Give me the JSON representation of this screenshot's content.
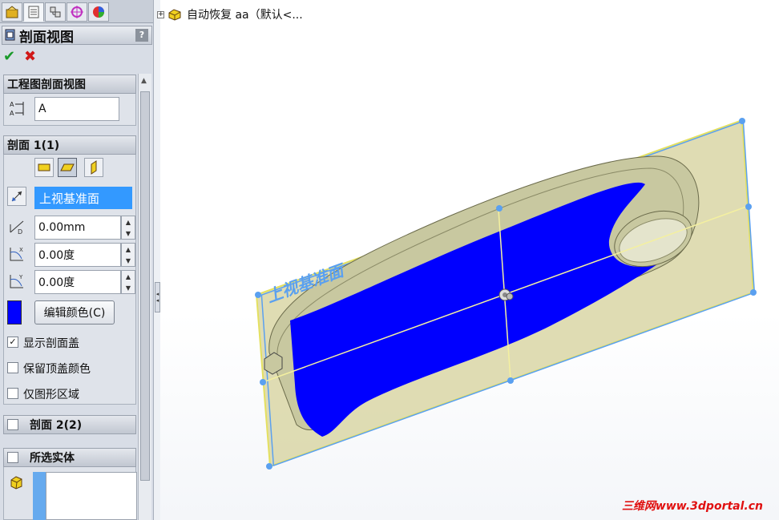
{
  "property_manager": {
    "title": "剖面视图",
    "help": "?",
    "ok_symbol": "✔",
    "cancel_symbol": "✖"
  },
  "groups": {
    "drawing_section": {
      "title": "工程图剖面视图",
      "label_value": "A"
    },
    "section1": {
      "title": "剖面 1(1)",
      "plane_value": "上视基准面",
      "distance_value": "0.00mm",
      "angle_x_value": "0.00度",
      "angle_y_value": "0.00度",
      "edit_color_label": "编辑颜色(C)",
      "color": "#0000ff",
      "show_cap_label": "显示剖面盖",
      "show_cap_checked": true,
      "keep_top_color_label": "保留顶盖颜色",
      "keep_top_color_checked": false,
      "graphics_only_label": "仅图形区域",
      "graphics_only_checked": false
    },
    "section2": {
      "title": "剖面 2(2)",
      "checked": false
    },
    "selected_bodies": {
      "title": "所选实体",
      "checked": false
    }
  },
  "tree": {
    "node_label": "自动恢复 aa（默认<..."
  },
  "viewport": {
    "plane_label": "上视基准面",
    "plane_color": "#5aa0f0",
    "section_fill": "#0000ff",
    "part_color": "#c8c8a0"
  },
  "watermark": "三维网www.3dportal.cn"
}
